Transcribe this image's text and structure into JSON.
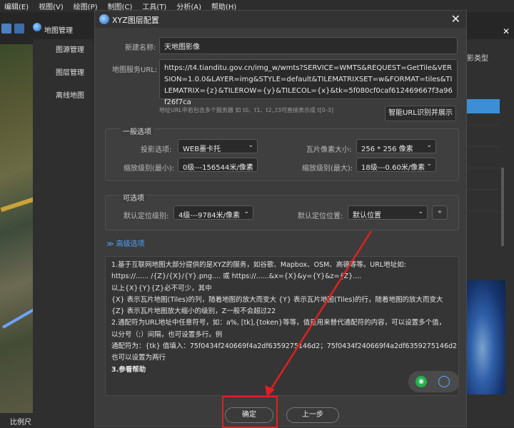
{
  "menu": [
    "编辑(E)",
    "视图(V)",
    "绘图(P)",
    "制图(C)",
    "工具(T)",
    "分析(A)",
    "帮助(H)"
  ],
  "background_app": {
    "map_manager_title": "地图管理",
    "left_nav": [
      "图源管理",
      "图层管理",
      "离线地图"
    ],
    "right_column_header": "影类型",
    "bottom_left_label": "比例尺"
  },
  "dialog": {
    "title": "XYZ图层配置",
    "new_name_label": "新建名称:",
    "new_name_value": "天地图影像",
    "url_label": "地图服务URL:",
    "url_value": "https://t4.tianditu.gov.cn/img_w/wmts?SERVICE=WMTS&REQUEST=GetTile&VERSION=1.0.0&LAYER=img&STYLE=default&TILEMATRIXSET=w&FORMAT=tiles&TILEMATRIX={z}&TILEROW={y}&TILECOL={x}&tk=5f080cf0caf612469667f3a96f26f7ca",
    "url_hint": "地址URL中若包含多个服务器 如 t0、t1、t2,,t3可直接表示成 t[0-3]",
    "smart_button": "智能URL识别并展示",
    "general_group": {
      "title": "一般选项",
      "projection_label": "投影选项:",
      "projection_value": "WEB墨卡托",
      "tile_size_label": "瓦片像素大小:",
      "tile_size_value": "256 * 256 像素",
      "zoom_min_label": "缩放级别(最小):",
      "zoom_min_value": "0级---156544米/像素",
      "zoom_max_label": "缩放级别(最大):",
      "zoom_max_value": "18级---0.60米/像素"
    },
    "optional_group": {
      "title": "可选项",
      "default_zoom_label": "默认定位级别:",
      "default_zoom_value": "4级---9784米/像素",
      "default_location_label": "默认定位位置:",
      "default_location_value": "默认位置"
    },
    "advanced_link": "≫ 高级选项",
    "help_lines": [
      "1.基于互联网地图大部分提供的是XYZ的服务，如谷歌、Mapbox、OSM、高德等等。URL地址如:",
      "https://...... /{Z}/{X}/{Y}.png....     或     https://......&x={X}&y={Y}&z={Z}....",
      "以上{X}{Y}{Z}必不可少，其中",
      "{X}   表示瓦片地图(Tiles)的列，随着地图的放大而变大          {Y}   表示瓦片地图(Tiles)的行，随着地图的放大而变大",
      "{Z}   表示瓦片地图放大缩小的级别，Z一般不会超过22",
      "2.通配符为URL地址中任意符号，如：a%, [tk],{token}等等，值是用来替代通配符的内容，可以设置多个值，",
      "以分号（;）间隔，也可设置多行。例",
      "通配符为：{tk} 值填入：75f0434f240669f4a2df6359275146d2；75f0434f240669f4a2df6359275146d2",
      "也可以设置为两行",
      "3.参看帮助"
    ],
    "ok_button": "确定",
    "prev_button": "上一步"
  },
  "colors": {
    "accent_blue": "#4ea3ff",
    "annotation_red": "#e02020",
    "wechat_green": "#23b14d"
  }
}
